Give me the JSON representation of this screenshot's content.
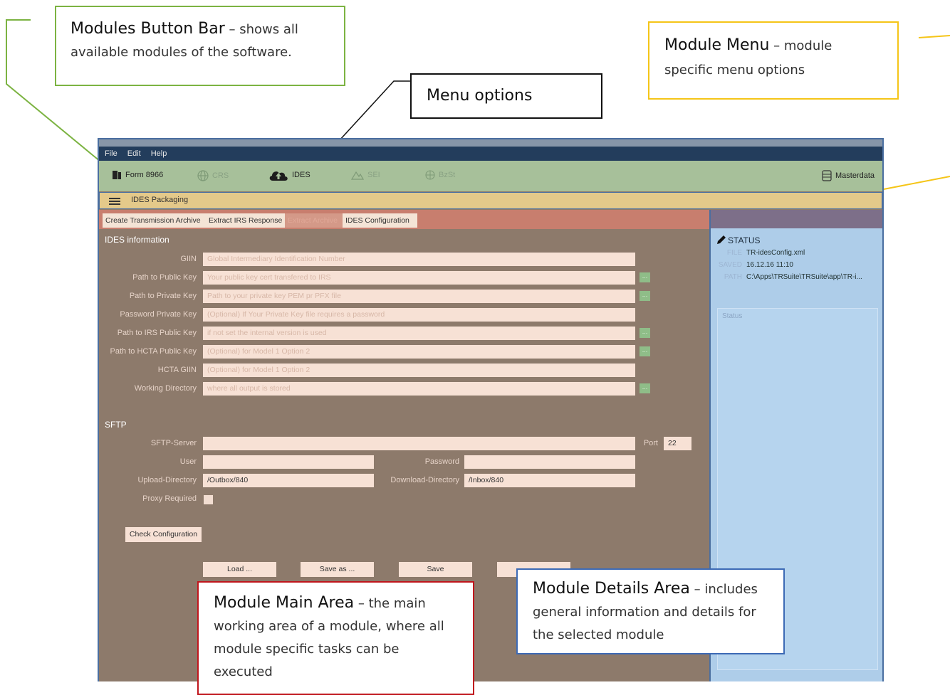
{
  "callouts": {
    "modules_bar": {
      "title": "Modules Button Bar",
      "text": " – shows all available modules of the software."
    },
    "menu_options": {
      "title": "Menu options"
    },
    "module_menu": {
      "title": "Module Menu",
      "text": " – module specific menu options"
    },
    "main_area": {
      "title": "Module Main Area",
      "text": " – the main working area of a module, where all module specific tasks can be executed"
    },
    "details_area": {
      "title": "Module Details Area",
      "text": " – includes general information and details for the selected module"
    }
  },
  "menu": {
    "file": "File",
    "edit": "Edit",
    "help": "Help"
  },
  "modules": {
    "form8966": "Form 8966",
    "crs": "CRS",
    "ides": "IDES",
    "sei": "SEI",
    "bzst": "BzSt",
    "masterdata": "Masterdata"
  },
  "module_menu": {
    "title": "IDES Packaging"
  },
  "tabs": [
    "Create Transmission Archive",
    "Extract IRS Response",
    "Extract Archive",
    "IDES Configuration"
  ],
  "ides": {
    "section": "IDES information",
    "fields": [
      {
        "label": "GIIN",
        "placeholder": "Global Intermediary Identification Number"
      },
      {
        "label": "Path to Public Key",
        "placeholder": "Your public key cert transfered to IRS"
      },
      {
        "label": "Path to Private Key",
        "placeholder": "Path to your private key PEM pr PFX file"
      },
      {
        "label": "Password Private Key",
        "placeholder": "(Optional) If Your Private Key file requires a password"
      },
      {
        "label": "Path to IRS Public Key",
        "placeholder": "if not set the internal version is used"
      },
      {
        "label": "Path to HCTA Public Key",
        "placeholder": "(Optional) for Model 1 Option 2"
      },
      {
        "label": "HCTA GIIN",
        "placeholder": "(Optional) for Model 1 Option 2"
      },
      {
        "label": "Working Directory",
        "placeholder": "where all output is stored"
      }
    ],
    "browse": "..."
  },
  "sftp": {
    "section": "SFTP",
    "server_label": "SFTP-Server",
    "port_label": "Port",
    "port_value": "22",
    "user_label": "User",
    "password_label": "Password",
    "upload_label": "Upload-Directory",
    "upload_value": "/Outbox/840",
    "download_label": "Download-Directory",
    "download_value": "/Inbox/840",
    "proxy_label": "Proxy Required"
  },
  "buttons": {
    "check": "Check Configuration",
    "load": "Load ...",
    "saveas": "Save as ...",
    "save": "Save"
  },
  "details": {
    "status_title": "STATUS",
    "file_label": "FILE",
    "file_value": "TR-idesConfig.xml",
    "saved_label": "SAVED",
    "saved_value": "16.12.16 11:10",
    "path_label": "PATH",
    "path_value": "C:\\Apps\\TRSuite\\TRSuite\\app\\TR-i...",
    "status_box": "Status"
  },
  "colors": {
    "menubar": "#233d5c",
    "module_bar": "#a7c09a",
    "module_menu": "#e4c98a",
    "tabs_bar": "#c87e6e",
    "main_area": "#8d7a6b",
    "details_area": "#aecde9",
    "callout_green": "#7cb342",
    "callout_yellow": "#f5c518",
    "callout_red": "#c0161c",
    "callout_blue": "#3d6ab5"
  }
}
